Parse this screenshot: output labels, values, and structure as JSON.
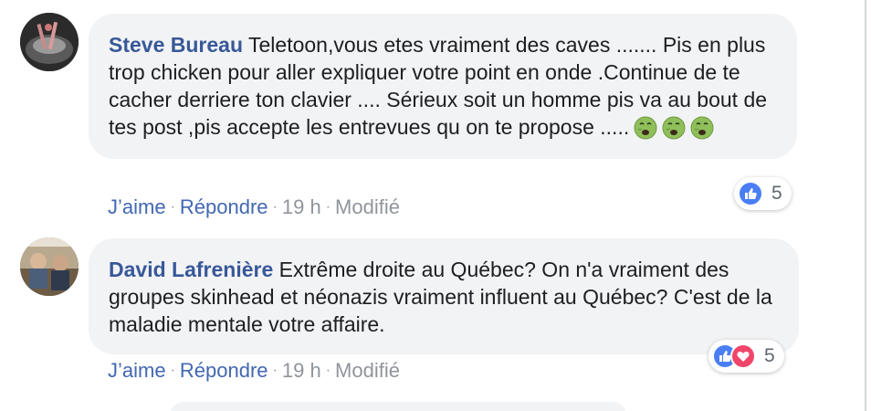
{
  "comments": [
    {
      "author": "Steve Bureau",
      "text": "Teletoon,vous etes vraiment des caves ....... Pis en plus trop chicken pour aller expliquer votre point en onde .Continue de te cacher derriere ton clavier .... Sérieux soit un homme pis va au bout de tes post ,pis accepte les entrevues qu on te propose .....",
      "emojis": [
        "nauseated-face",
        "nauseated-face",
        "nauseated-face"
      ],
      "like_label": "J’aime",
      "reply_label": "Répondre",
      "time": "19 h",
      "edited_label": "Modifié",
      "reactions": [
        "like"
      ],
      "reaction_count": "5"
    },
    {
      "author": "David Lafrenière",
      "text": "Extrême droite au Québec? On n'a vraiment des groupes skinhead et néonazis vraiment influent au Québec? C'est de la maladie mentale votre affaire.",
      "like_label": "J’aime",
      "reply_label": "Répondre",
      "time": "19 h",
      "edited_label": "Modifié",
      "reactions": [
        "like",
        "love"
      ],
      "reaction_count": "5"
    }
  ],
  "colors": {
    "author": "#385898",
    "action_link": "#4267b2",
    "meta": "#90949c",
    "bubble_bg": "#f2f3f5",
    "like": "#4a7ef5",
    "love": "#f0466a"
  }
}
